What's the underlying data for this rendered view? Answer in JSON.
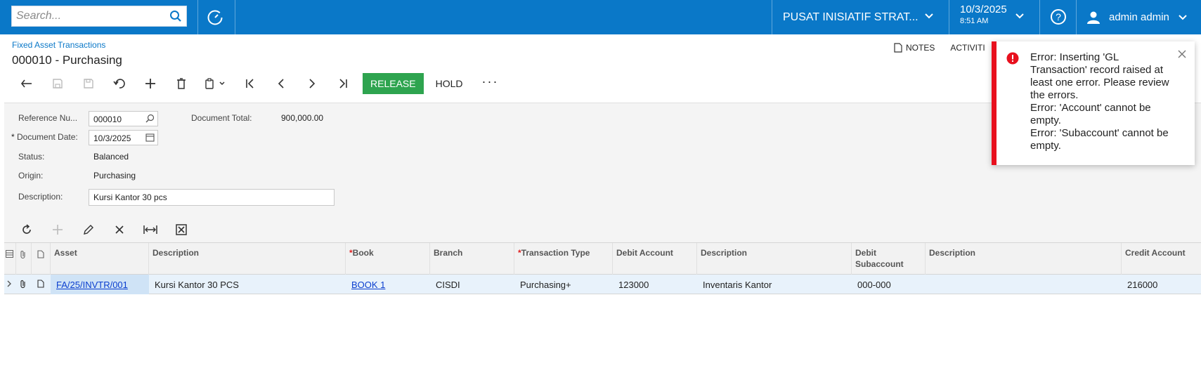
{
  "topbar": {
    "search_placeholder": "Search...",
    "company": "PUSAT INISIATIF STRAT...",
    "date": "10/3/2025",
    "time": "8:51 AM",
    "user": "admin admin"
  },
  "page": {
    "breadcrumb": "Fixed Asset Transactions",
    "title": "000010 - Purchasing",
    "notes_label": "NOTES",
    "activities_label": "ACTIVITI"
  },
  "toolbar": {
    "release_label": "RELEASE",
    "hold_label": "HOLD",
    "more_label": "···"
  },
  "form": {
    "ref_label": "Reference Nu...",
    "ref_value": "000010",
    "doc_total_label": "Document Total:",
    "doc_total_value": "900,000.00",
    "doc_date_label": "Document Date:",
    "doc_date_value": "10/3/2025",
    "status_label": "Status:",
    "status_value": "Balanced",
    "origin_label": "Origin:",
    "origin_value": "Purchasing",
    "desc_label": "Description:",
    "desc_value": "Kursi Kantor 30 pcs"
  },
  "grid": {
    "headers": {
      "asset": "Asset",
      "description": "Description",
      "book": "Book",
      "branch": "Branch",
      "transaction_type": "Transaction Type",
      "debit_account": "Debit Account",
      "debit_description": "Description",
      "debit_subaccount": "Debit\nSubaccount",
      "sub_description": "Description",
      "credit_account": "Credit Account"
    },
    "rows": [
      {
        "asset": "FA/25/INVTR/001",
        "description": "Kursi Kantor 30 PCS",
        "book": "BOOK 1",
        "branch": "CISDI",
        "transaction_type": "Purchasing+",
        "debit_account": "123000",
        "debit_description": "Inventaris Kantor",
        "debit_subaccount": "000-000",
        "sub_description": "",
        "credit_account": "216000"
      }
    ]
  },
  "error_popup": {
    "message_lines": [
      "Error: Inserting  'GL Transaction' record raised at least one error. Please review the errors.",
      "Error: 'Account' cannot be empty.",
      "Error: 'Subaccount' cannot be empty."
    ]
  },
  "colors": {
    "topbar": "#0a78c8",
    "release": "#2ea44f",
    "error": "#e8101e"
  }
}
